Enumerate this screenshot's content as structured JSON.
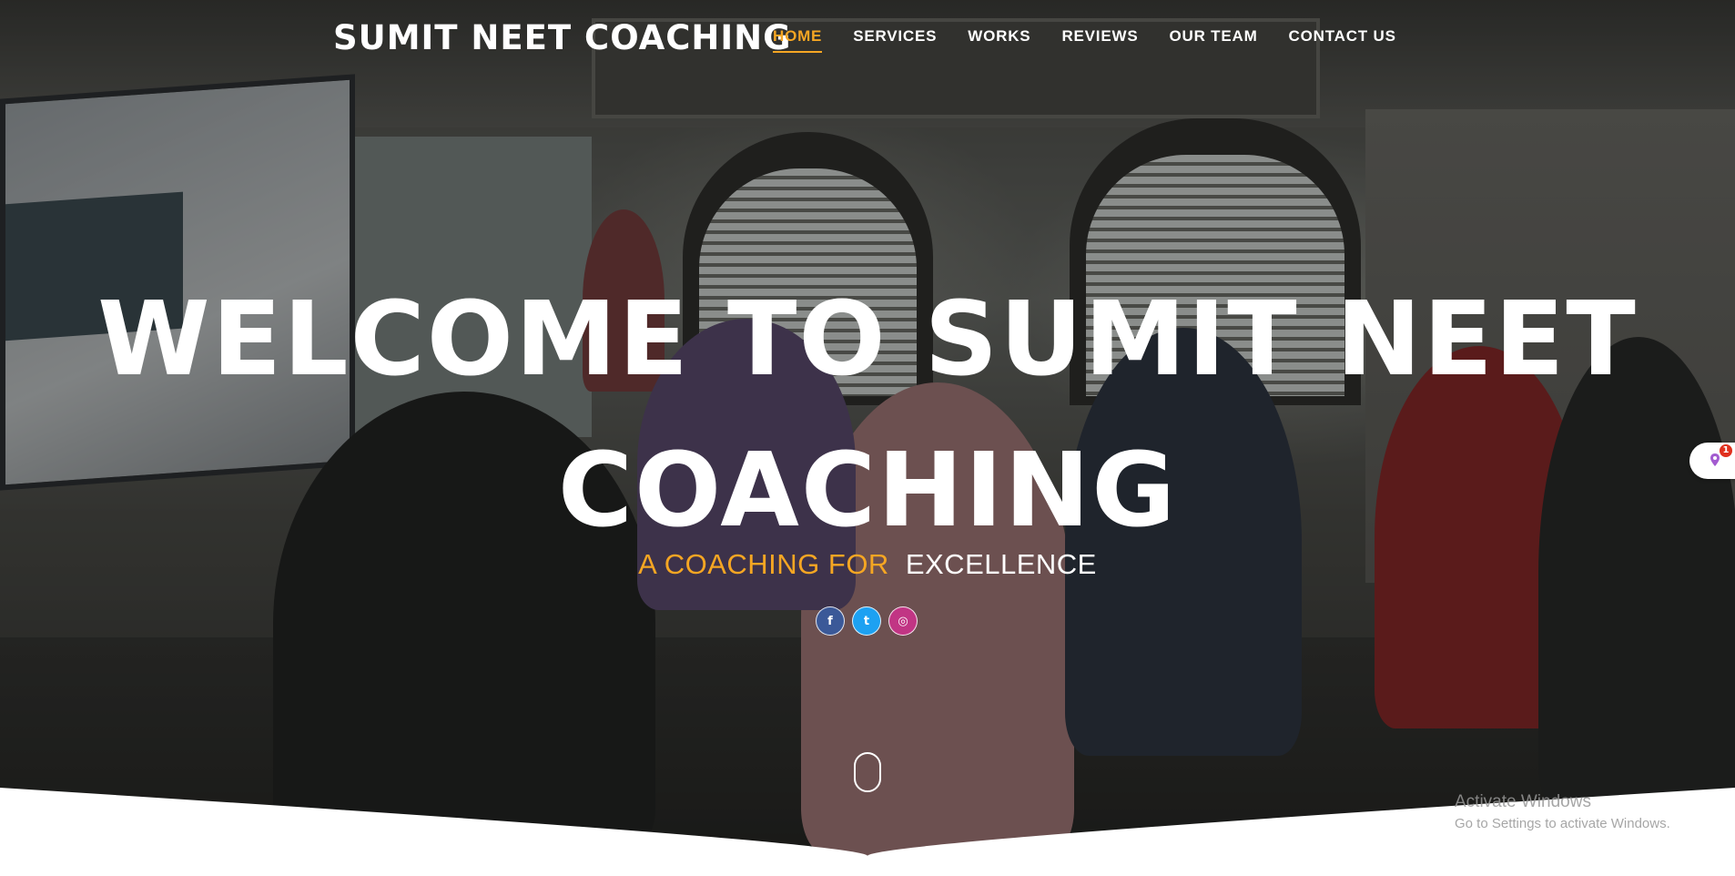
{
  "brand": {
    "name": "SUMIT NEET COACHING"
  },
  "nav": {
    "items": [
      {
        "label": "HOME",
        "active": true
      },
      {
        "label": "SERVICES",
        "active": false
      },
      {
        "label": "WORKS",
        "active": false
      },
      {
        "label": "REVIEWS",
        "active": false
      },
      {
        "label": "OUR TEAM",
        "active": false
      },
      {
        "label": "CONTACT US",
        "active": false
      }
    ]
  },
  "hero": {
    "title_line1": "WELCOME TO SUMIT NEET",
    "title_line2": "COACHING",
    "tagline_accent": "A COACHING FOR",
    "tagline_plain": "EXCELLENCE",
    "accent_color": "#f5a623"
  },
  "socials": [
    {
      "icon": "facebook-icon",
      "glyph": "f",
      "color": "#3b5998"
    },
    {
      "icon": "twitter-icon",
      "glyph": "t",
      "color": "#1da1f2"
    },
    {
      "icon": "instagram-icon",
      "glyph": "◎",
      "color": "#c13584"
    }
  ],
  "floating_widget": {
    "badge_count": "1"
  },
  "watermark": {
    "line1": "Activate Windows",
    "line2": "Go to Settings to activate Windows."
  }
}
